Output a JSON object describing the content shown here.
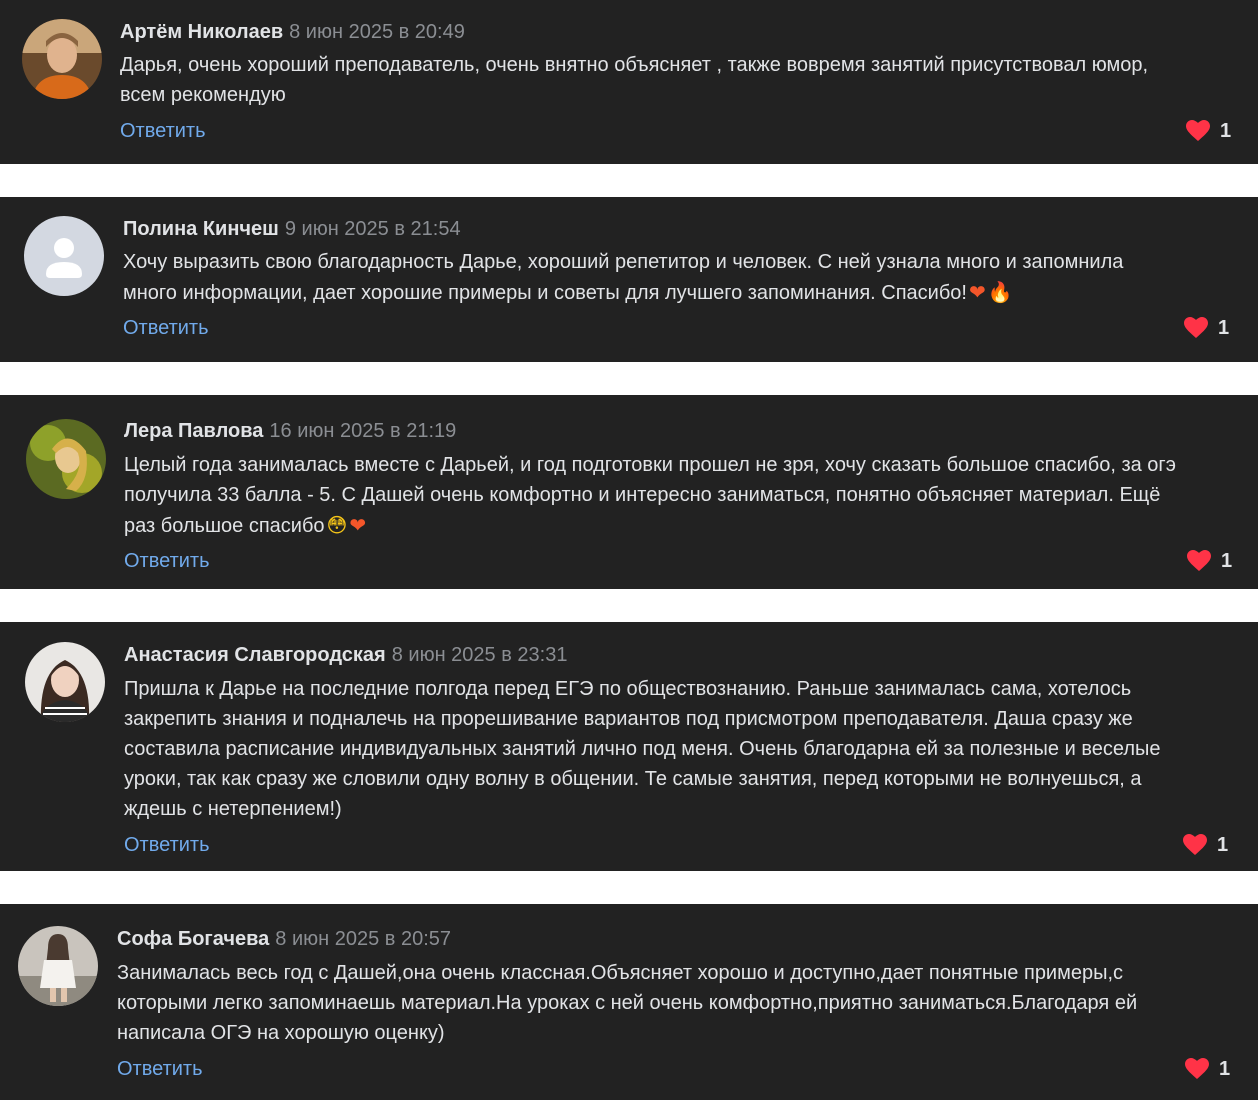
{
  "colors": {
    "card_background": "#222222",
    "page_background": "#ffffff",
    "author": "#e1e3e6",
    "date": "#8b8e93",
    "reply_link": "#71aaeb",
    "like_heart": "#ff3347"
  },
  "comments": [
    {
      "author": "Артём Николаев",
      "date": "8 июн 2025 в 20:49",
      "text": "Дарья, очень хороший преподаватель, очень внятно объясняет , также вовремя занятий присутствовал юмор,\nвсем рекомендую",
      "emoji": "",
      "reply_label": "Ответить",
      "likes": "1",
      "avatar": "photo-avatar"
    },
    {
      "author": "Полина Кинчеш",
      "date": "9 июн 2025 в 21:54",
      "text": "Хочу выразить свою благодарность Дарье, хороший репетитор и человек. С ней узнала много и запомнила\nмного информации, дает хорошие примеры и советы для лучшего запоминания. Спасибо!",
      "emoji": "orange-heart-emoji fire-emoji",
      "reply_label": "Ответить",
      "likes": "1",
      "avatar": "default-user-avatar"
    },
    {
      "author": "Лера Павлова",
      "date": "16 июн 2025 в 21:19",
      "text": "Целый года занималась вместе с Дарьей, и год подготовки прошел не зря, хочу сказать большое спасибо, за огэ\nполучила 33 балла - 5. С Дашей очень комфортно и интересно заниматься, понятно объясняет материал. Ещё\nраз большое спасибо",
      "emoji": "flushed-face-emoji orange-heart-emoji",
      "reply_label": "Ответить",
      "likes": "1",
      "avatar": "photo-avatar"
    },
    {
      "author": "Анастасия Славгородская",
      "date": "8 июн 2025 в 23:31",
      "text": "Пришла к Дарье на последние полгода перед ЕГЭ по обществознанию. Раньше занималась сама, хотелось\nзакрепить знания и подналечь на прорешивание вариантов под присмотром преподавателя. Даша сразу же\nсоставила расписание индивидуальных занятий лично под меня. Очень благодарна ей за полезные и веселые\nуроки, так как сразу же словили одну волну в общении. Те самые занятия, перед которыми не волнуешься, а\nждешь с нетерпением!)",
      "emoji": "",
      "reply_label": "Ответить",
      "likes": "1",
      "avatar": "photo-avatar"
    },
    {
      "author": "Софа Богачева",
      "date": "8 июн 2025 в 20:57",
      "text": "Занималась весь год с Дашей,она очень классная.Объясняет хорошо и доступно,дает понятные примеры,с\nкоторыми легко запоминаешь материал.На уроках с ней очень комфортно,приятно заниматься.Благодаря ей\nнаписала ОГЭ на хорошую оценку)",
      "emoji": "",
      "reply_label": "Ответить",
      "likes": "1",
      "avatar": "photo-avatar"
    }
  ]
}
